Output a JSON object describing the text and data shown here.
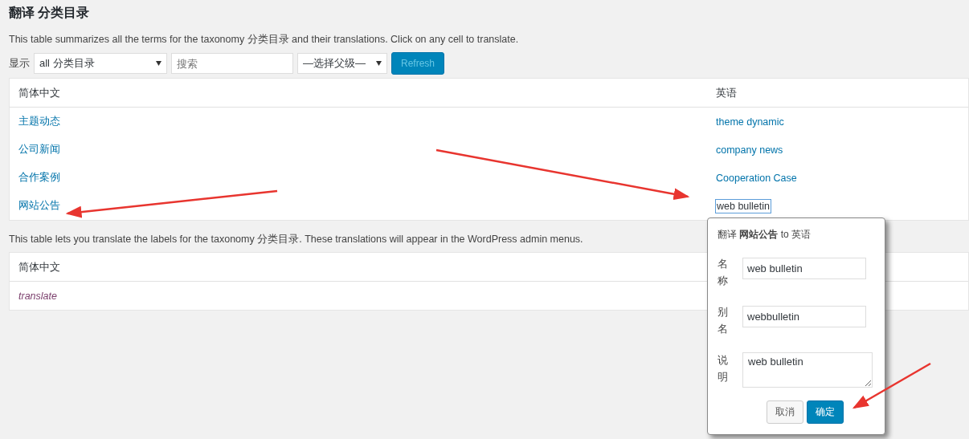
{
  "title": "翻译 分类目录",
  "summary": "This table summarizes all the terms for the taxonomy 分类目录 and their translations. Click on any cell to translate.",
  "filter": {
    "show_label": "显示",
    "show_value": "all 分类目录",
    "search_placeholder": "搜索",
    "parent_value": "—选择父级—",
    "refresh": {
      "label": "Refresh",
      "disabled": true
    }
  },
  "terms_table": {
    "columns": [
      "简体中文",
      "英语"
    ],
    "rows": [
      {
        "source": "主题动态",
        "translation": "theme dynamic",
        "selected": false
      },
      {
        "source": "公司新闻",
        "translation": "company news",
        "selected": false
      },
      {
        "source": "合作案例",
        "translation": "Cooperation Case",
        "selected": false
      },
      {
        "source": "网站公告",
        "translation": "web bulletin",
        "selected": true
      }
    ]
  },
  "labels_note": "This table lets you translate the labels for the taxonomy 分类目录. These translations will appear in the WordPress admin menus.",
  "labels_table": {
    "columns": [
      "简体中文"
    ],
    "rows": [
      {
        "source": "translate"
      }
    ]
  },
  "popup": {
    "title": "翻译 **网站公告** to 英语",
    "fields": [
      {
        "label": "名称",
        "value": "web bulletin",
        "kind": "input"
      },
      {
        "label": "别名",
        "value": "webbulletin",
        "kind": "input"
      },
      {
        "label": "说明",
        "value": "web bulletin",
        "kind": "textarea"
      }
    ],
    "cancel": "取消",
    "confirm": "确定"
  }
}
